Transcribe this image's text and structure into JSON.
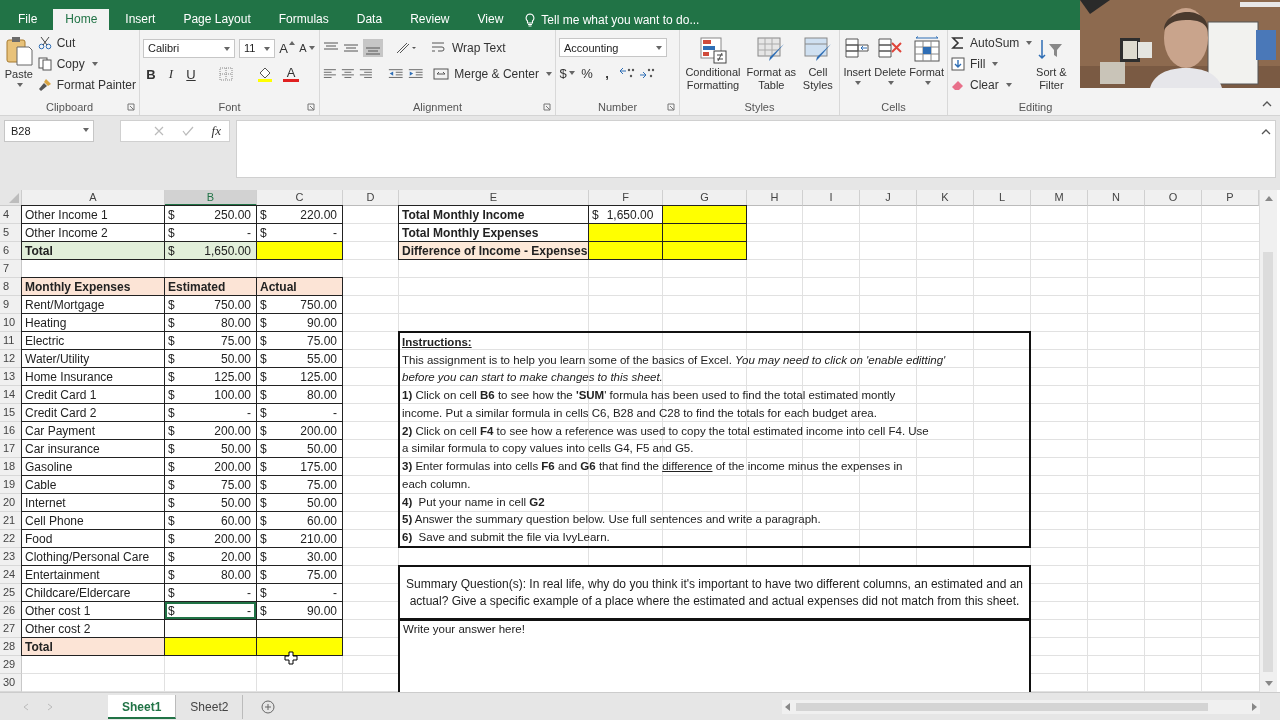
{
  "ribbon": {
    "tabs": [
      {
        "label": "File",
        "selected": false
      },
      {
        "label": "Home",
        "selected": true
      },
      {
        "label": "Insert",
        "selected": false
      },
      {
        "label": "Page Layout",
        "selected": false
      },
      {
        "label": "Formulas",
        "selected": false
      },
      {
        "label": "Data",
        "selected": false
      },
      {
        "label": "Review",
        "selected": false
      },
      {
        "label": "View",
        "selected": false
      }
    ],
    "tell_me": "Tell me what you want to do...",
    "clipboard": {
      "label": "Clipboard",
      "paste": "Paste",
      "cut": "Cut",
      "copy": "Copy",
      "format_painter": "Format Painter"
    },
    "font": {
      "label": "Font",
      "name": "Calibri",
      "size": "11",
      "grow": "A",
      "shrink": "A",
      "bold": "B",
      "italic": "I",
      "underline": "U",
      "font_color": "A"
    },
    "alignment": {
      "label": "Alignment",
      "wrap_text": "Wrap Text",
      "merge_center": "Merge & Center"
    },
    "number": {
      "label": "Number",
      "format": "Accounting",
      "currency": "$",
      "percent": "%",
      "comma": ","
    },
    "styles": {
      "label": "Styles",
      "conditional": "Conditional Formatting",
      "format_table": "Format as Table",
      "cell_styles": "Cell Styles"
    },
    "cells": {
      "label": "Cells",
      "insert": "Insert",
      "delete": "Delete",
      "format": "Format"
    },
    "editing": {
      "label": "Editing",
      "autosum": "AutoSum",
      "fill": "Fill",
      "clear": "Clear",
      "sort_filter": "Sort & Filter"
    }
  },
  "formula_bar": {
    "name_box": "B28",
    "fx": "fx"
  },
  "sheet": {
    "columns": [
      {
        "label": "A",
        "selected": false
      },
      {
        "label": "B",
        "selected": true
      },
      {
        "label": "C",
        "selected": false
      },
      {
        "label": "D",
        "selected": false
      },
      {
        "label": "E",
        "selected": false
      },
      {
        "label": "F",
        "selected": false
      },
      {
        "label": "G",
        "selected": false
      },
      {
        "label": "H",
        "selected": false
      },
      {
        "label": "I",
        "selected": false
      },
      {
        "label": "J",
        "selected": false
      },
      {
        "label": "K",
        "selected": false
      },
      {
        "label": "L",
        "selected": false
      },
      {
        "label": "M",
        "selected": false
      },
      {
        "label": "N",
        "selected": false
      },
      {
        "label": "O",
        "selected": false
      },
      {
        "label": "P",
        "selected": false
      }
    ],
    "rows": [
      {
        "number": "4",
        "budget": [
          {
            "text": "Other Income 1",
            "bold": false,
            "selected": false
          },
          {
            "currency": "$",
            "amount": "250.00",
            "selected": false
          },
          {
            "currency": "$",
            "amount": "220.00",
            "selected": false
          }
        ],
        "summary": [
          {
            "text": "Total Monthly Income",
            "bold": true,
            "selected": false
          },
          {
            "currency": "$",
            "amount": "1,650.00",
            "selected": false
          },
          {
            "color": "#ffff00",
            "selected": false
          }
        ]
      },
      {
        "number": "5",
        "budget": [
          {
            "text": "Other Income 2",
            "bold": false,
            "selected": false
          },
          {
            "currency": "$",
            "amount": "-",
            "selected": false
          },
          {
            "currency": "$",
            "amount": "-",
            "selected": false
          }
        ],
        "summary": [
          {
            "text": "Total Monthly Expenses",
            "bold": true,
            "selected": false
          },
          {
            "color": "#ffff00",
            "selected": false
          },
          {
            "color": "#ffff00",
            "selected": false
          }
        ]
      },
      {
        "number": "6",
        "budget": [
          {
            "text": "Total",
            "bold": true,
            "color": "#e2efda",
            "selected": false
          },
          {
            "currency": "$",
            "amount": "1,650.00",
            "color": "#e2efda",
            "selected": false
          },
          {
            "color": "#ffff00",
            "selected": false
          }
        ],
        "summary": [
          {
            "text": "Difference of Income - Expenses",
            "bold": true,
            "color": "#fde9d9",
            "selected": false
          },
          {
            "color": "#ffff00",
            "selected": false
          },
          {
            "color": "#ffff00",
            "selected": false
          }
        ]
      },
      {
        "number": "7"
      },
      {
        "number": "8",
        "budget": [
          {
            "text": "Monthly Expenses",
            "bold": true,
            "color": "#fce4d6",
            "selected": false
          },
          {
            "text": "Estimated",
            "bold": true,
            "color": "#fce4d6",
            "selected": false
          },
          {
            "text": "Actual",
            "bold": true,
            "color": "#fce4d6",
            "selected": false
          }
        ]
      },
      {
        "number": "9",
        "budget": [
          {
            "text": "Rent/Mortgage",
            "bold": false,
            "selected": false
          },
          {
            "currency": "$",
            "amount": "750.00",
            "selected": false
          },
          {
            "currency": "$",
            "amount": "750.00",
            "selected": false
          }
        ]
      },
      {
        "number": "10",
        "budget": [
          {
            "text": "Heating",
            "bold": false,
            "selected": false
          },
          {
            "currency": "$",
            "amount": "80.00",
            "selected": false
          },
          {
            "currency": "$",
            "amount": "90.00",
            "selected": false
          }
        ]
      },
      {
        "number": "11",
        "budget": [
          {
            "text": "Electric",
            "bold": false,
            "selected": false
          },
          {
            "currency": "$",
            "amount": "75.00",
            "selected": false
          },
          {
            "currency": "$",
            "amount": "75.00",
            "selected": false
          }
        ]
      },
      {
        "number": "12",
        "budget": [
          {
            "text": "Water/Utility",
            "bold": false,
            "selected": false
          },
          {
            "currency": "$",
            "amount": "50.00",
            "selected": false
          },
          {
            "currency": "$",
            "amount": "55.00",
            "selected": false
          }
        ]
      },
      {
        "number": "13",
        "budget": [
          {
            "text": "Home Insurance",
            "bold": false,
            "selected": false
          },
          {
            "currency": "$",
            "amount": "125.00",
            "selected": false
          },
          {
            "currency": "$",
            "amount": "125.00",
            "selected": false
          }
        ]
      },
      {
        "number": "14",
        "budget": [
          {
            "text": "Credit Card 1",
            "bold": false,
            "selected": false
          },
          {
            "currency": "$",
            "amount": "100.00",
            "selected": false
          },
          {
            "currency": "$",
            "amount": "80.00",
            "selected": false
          }
        ]
      },
      {
        "number": "15",
        "budget": [
          {
            "text": "Credit Card 2",
            "bold": false,
            "selected": false
          },
          {
            "currency": "$",
            "amount": "-",
            "selected": false
          },
          {
            "currency": "$",
            "amount": "-",
            "selected": false
          }
        ]
      },
      {
        "number": "16",
        "budget": [
          {
            "text": "Car Payment",
            "bold": false,
            "selected": false
          },
          {
            "currency": "$",
            "amount": "200.00",
            "selected": false
          },
          {
            "currency": "$",
            "amount": "200.00",
            "selected": false
          }
        ]
      },
      {
        "number": "17",
        "budget": [
          {
            "text": "Car insurance",
            "bold": false,
            "selected": false
          },
          {
            "currency": "$",
            "amount": "50.00",
            "selected": false
          },
          {
            "currency": "$",
            "amount": "50.00",
            "selected": false
          }
        ]
      },
      {
        "number": "18",
        "budget": [
          {
            "text": "Gasoline",
            "bold": false,
            "selected": false
          },
          {
            "currency": "$",
            "amount": "200.00",
            "selected": false
          },
          {
            "currency": "$",
            "amount": "175.00",
            "selected": false
          }
        ]
      },
      {
        "number": "19",
        "budget": [
          {
            "text": "Cable",
            "bold": false,
            "selected": false
          },
          {
            "currency": "$",
            "amount": "75.00",
            "selected": false
          },
          {
            "currency": "$",
            "amount": "75.00",
            "selected": false
          }
        ]
      },
      {
        "number": "20",
        "budget": [
          {
            "text": "Internet",
            "bold": false,
            "selected": false
          },
          {
            "currency": "$",
            "amount": "50.00",
            "selected": false
          },
          {
            "currency": "$",
            "amount": "50.00",
            "selected": false
          }
        ]
      },
      {
        "number": "21",
        "budget": [
          {
            "text": "Cell Phone",
            "bold": false,
            "selected": false
          },
          {
            "currency": "$",
            "amount": "60.00",
            "selected": false
          },
          {
            "currency": "$",
            "amount": "60.00",
            "selected": false
          }
        ]
      },
      {
        "number": "22",
        "budget": [
          {
            "text": "Food",
            "bold": false,
            "selected": false
          },
          {
            "currency": "$",
            "amount": "200.00",
            "selected": false
          },
          {
            "currency": "$",
            "amount": "210.00",
            "selected": false
          }
        ]
      },
      {
        "number": "23",
        "budget": [
          {
            "text": "Clothing/Personal Care",
            "bold": false,
            "selected": false
          },
          {
            "currency": "$",
            "amount": "20.00",
            "selected": false
          },
          {
            "currency": "$",
            "amount": "30.00",
            "selected": false
          }
        ]
      },
      {
        "number": "24",
        "budget": [
          {
            "text": "Entertainment",
            "bold": false,
            "selected": false
          },
          {
            "currency": "$",
            "amount": "80.00",
            "selected": false
          },
          {
            "currency": "$",
            "amount": "75.00",
            "selected": false
          }
        ]
      },
      {
        "number": "25",
        "budget": [
          {
            "text": "Childcare/Eldercare",
            "bold": false,
            "selected": false
          },
          {
            "currency": "$",
            "amount": "-",
            "selected": false
          },
          {
            "currency": "$",
            "amount": "-",
            "selected": false
          }
        ]
      },
      {
        "number": "26",
        "budget": [
          {
            "text": "Other cost 1",
            "bold": false,
            "selected": false
          },
          {
            "currency": "$",
            "amount": "-",
            "selected": true
          },
          {
            "currency": "$",
            "amount": "90.00",
            "selected": false
          }
        ]
      },
      {
        "number": "27",
        "budget": [
          {
            "text": "Other cost 2",
            "bold": false,
            "selected": false
          },
          {
            "selected": false
          },
          {
            "selected": false
          }
        ]
      },
      {
        "number": "28",
        "budget": [
          {
            "text": "Total",
            "bold": true,
            "color": "#fce4d6",
            "selected": false
          },
          {
            "color": "#ffff00",
            "selected": false
          },
          {
            "color": "#ffff00",
            "selected": false
          }
        ]
      },
      {
        "number": "29"
      },
      {
        "number": "30"
      }
    ]
  },
  "instructions": {
    "title": "Instructions:",
    "lines": [
      {
        "text": "This assignment is to help you learn some of the basics of Excel. *You may need to click on 'enable editting'*",
        "italic": false
      },
      {
        "text": "before you can start to make changes to this sheet.",
        "italic": true
      },
      {
        "text": "**1)** Click on cell **B6** to see how the **'SUM**' formula has been used to find the total estimated montly",
        "italic": false
      },
      {
        "text": "income. Put a similar formula in cells C6, B28 and C28 to find the totals for each budget area.",
        "italic": false
      },
      {
        "text": "**2)** Click on cell **F4** to see how a reference was used to copy the total estimated income into cell F4. Use",
        "italic": false
      },
      {
        "text": "a similar formula to copy values into cells G4, F5 and G5.",
        "italic": false
      },
      {
        "text": "**3)** Enter formulas into cells **F6** and **G6** that find the ",
        "underlined": "difference",
        "after": " of the income minus the expenses in",
        "italic": false
      },
      {
        "text": "each column.",
        "italic": false
      },
      {
        "text": "**4)**  Put your name in cell **G2**",
        "italic": false
      },
      {
        "text": "**5)** Answer the summary question below. Use full sentences and write a paragraph.",
        "italic": false
      },
      {
        "text": "**6)**  Save and submit the file via IvyLearn.",
        "italic": false
      }
    ]
  },
  "summary_question": "Summary Question(s):  In real life, why do you think it's important to have two different columns, an estimated and an actual? Give a specific example of a place where the estimated and actual expenses did not match from this sheet.",
  "answer": {
    "placeholder": "Write your answer here!"
  },
  "sheet_tabs": [
    {
      "label": "Sheet1",
      "selected": true
    },
    {
      "label": "Sheet2",
      "selected": false
    }
  ]
}
